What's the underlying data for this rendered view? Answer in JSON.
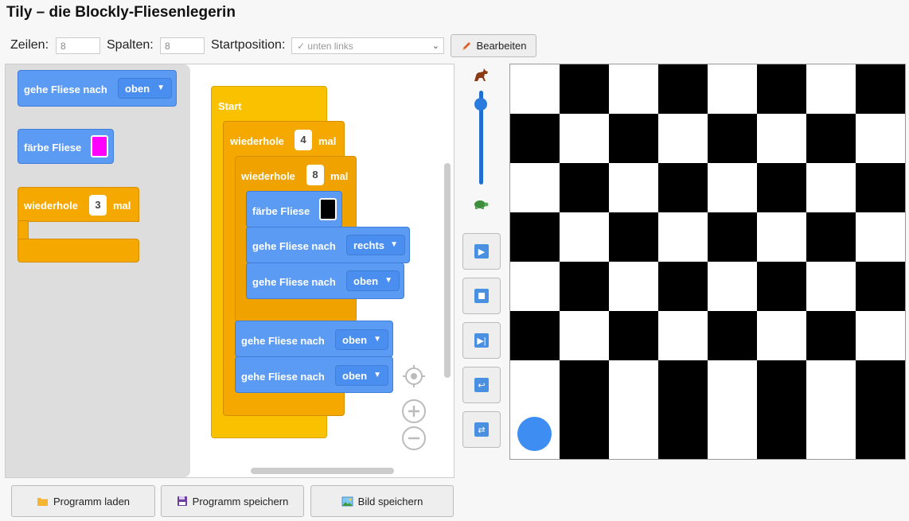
{
  "app": {
    "title": "Tily – die Blockly-Fliesenlegerin"
  },
  "toolbar": {
    "rows_label": "Zeilen:",
    "rows_value": "8",
    "cols_label": "Spalten:",
    "cols_value": "8",
    "start_label": "Startposition:",
    "start_value": "✓ unten links",
    "edit_label": "Bearbeiten"
  },
  "flyout": {
    "move_label": "gehe Fliese nach",
    "move_dir": "oben",
    "paint_label": "färbe Fliese",
    "paint_color": "#ff00ff",
    "repeat_label": "wiederhole",
    "repeat_count": "3",
    "repeat_suffix": "mal"
  },
  "program": {
    "start_label": "Start",
    "outer_repeat_label": "wiederhole",
    "outer_repeat_count": "4",
    "outer_repeat_suffix": "mal",
    "inner_repeat_label": "wiederhole",
    "inner_repeat_count": "8",
    "inner_repeat_suffix": "mal",
    "paint_label": "färbe Fliese",
    "paint_color": "#000000",
    "move1_label": "gehe Fliese nach",
    "move1_dir": "rechts",
    "move2_label": "gehe Fliese nach",
    "move2_dir": "oben",
    "move3_label": "gehe Fliese nach",
    "move3_dir": "oben",
    "move4_label": "gehe Fliese nach",
    "move4_dir": "oben"
  },
  "controls": {
    "fast_icon": "horse-icon",
    "slow_icon": "turtle-icon",
    "speed_level": 0.92,
    "buttons": [
      "play-icon",
      "stop-icon",
      "step-icon",
      "undo-icon",
      "reset-icon"
    ]
  },
  "grid": {
    "rows": 8,
    "cols": 8,
    "cells": [
      "wbwbwbwb",
      "bwbwbwbw",
      "wbwbwbwb",
      "bwbwbwbw",
      "wbwbwbwb",
      "bwbwbwbw",
      "wbwbwbwb",
      "wbwbwbwb"
    ],
    "robot_row": 8,
    "robot_col": 1,
    "robot_color": "#3d8df2"
  },
  "bottom": {
    "load_label": "Programm laden",
    "save_label": "Programm speichern",
    "image_label": "Bild speichern"
  }
}
